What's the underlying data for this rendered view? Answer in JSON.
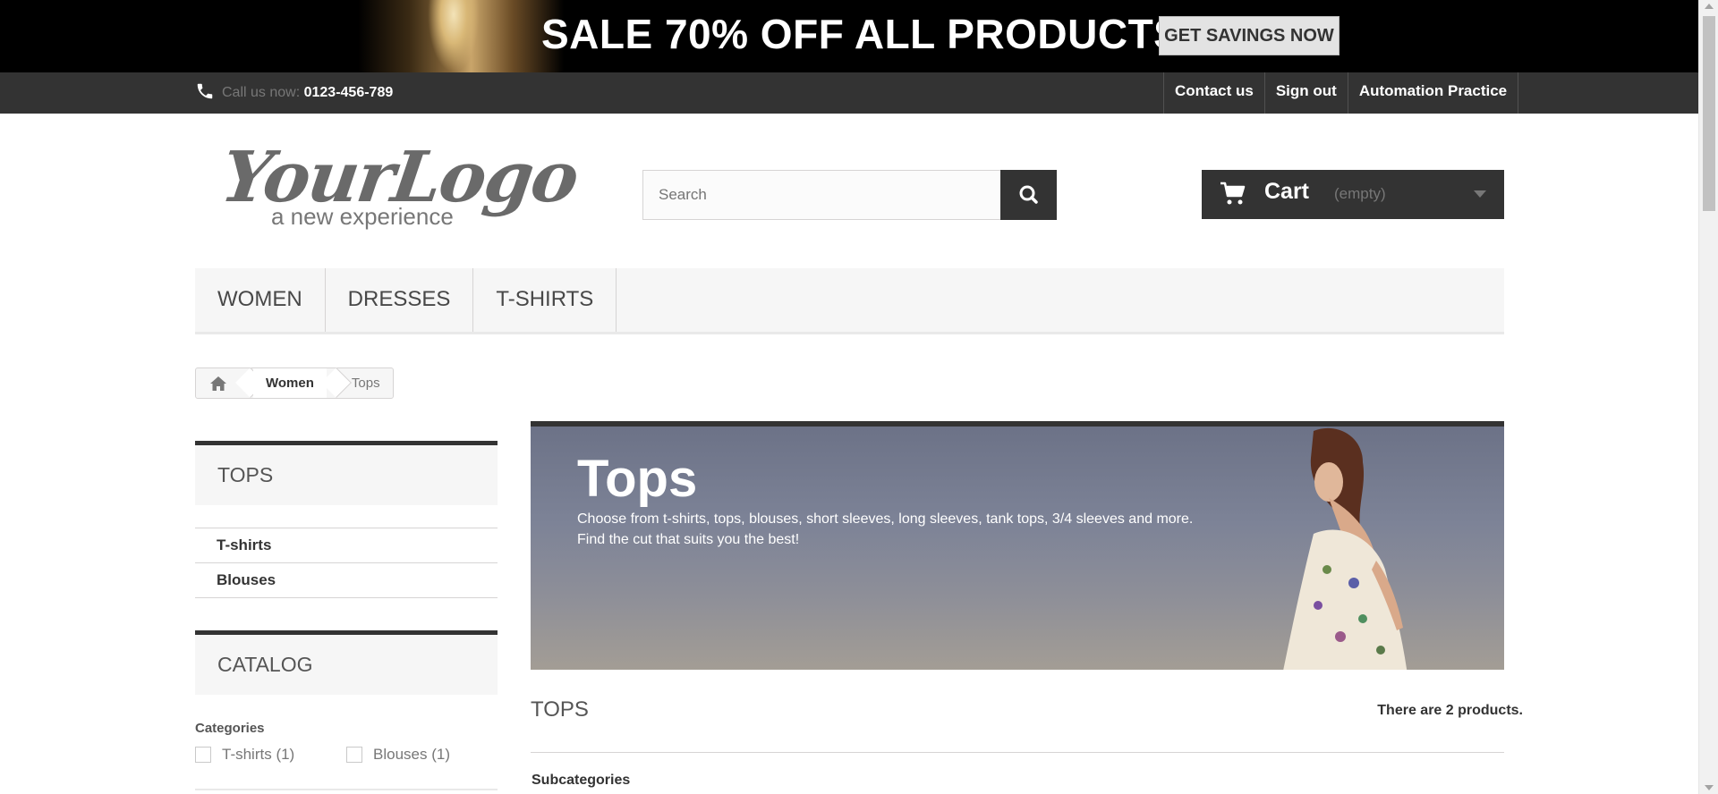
{
  "promo": {
    "headline": "SALE 70% OFF ALL PRODUCTS",
    "button": "GET SAVINGS NOW"
  },
  "topbar": {
    "call_label": "Call us now:",
    "phone": "0123-456-789",
    "links": [
      "Contact us",
      "Sign out",
      "Automation Practice"
    ]
  },
  "logo": {
    "main": "YourLogo",
    "tagline": "a new experience"
  },
  "search": {
    "placeholder": "Search",
    "value": ""
  },
  "cart": {
    "label": "Cart",
    "status": "(empty)"
  },
  "menu": [
    "WOMEN",
    "DRESSES",
    "T-SHIRTS"
  ],
  "breadcrumb": {
    "home_icon": "home-icon",
    "items": [
      "Women"
    ],
    "current": "Tops"
  },
  "sidebar": {
    "tops_title": "TOPS",
    "subcategories": [
      "T-shirts",
      "Blouses"
    ],
    "catalog_title": "CATALOG",
    "filter_title": "Categories",
    "filters": [
      {
        "label": "T-shirts (1)",
        "checked": false
      },
      {
        "label": "Blouses (1)",
        "checked": false
      }
    ]
  },
  "category": {
    "title": "Tops",
    "description_line1": "Choose from t-shirts, tops, blouses, short sleeves, long sleeves, tank tops, 3/4 sleeves and more.",
    "description_line2": "Find the cut that suits you the best!"
  },
  "main": {
    "heading": "TOPS",
    "count": "There are 2 products.",
    "subcategories_label": "Subcategories"
  },
  "colors": {
    "dark": "#333333",
    "light_bg": "#f6f6f6",
    "border": "#d6d4d4"
  }
}
